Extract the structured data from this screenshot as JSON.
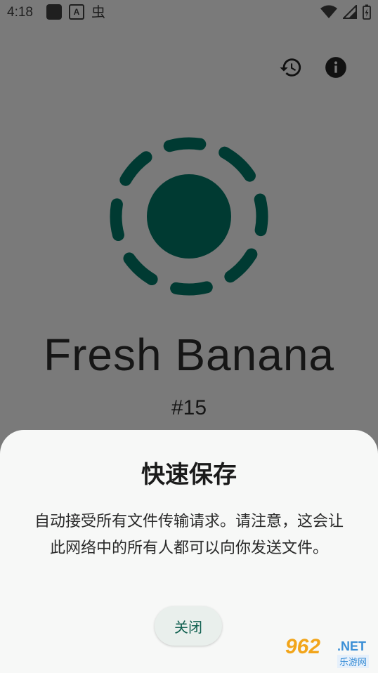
{
  "status_bar": {
    "time": "4:18",
    "a_label": "A",
    "bug_glyph": "虫"
  },
  "actions": {
    "history_icon": "history-icon",
    "info_icon": "info-icon"
  },
  "device": {
    "name": "Fresh Banana",
    "number": "#15"
  },
  "dialog": {
    "title": "快速保存",
    "body": "自动接受所有文件传输请求。请注意，这会让此网络中的所有人都可以向你发送文件。",
    "close_label": "关闭"
  },
  "watermark": {
    "number": "962",
    "suffix": ".NET",
    "site": "乐游网"
  },
  "colors": {
    "logo": "#003a32",
    "accent": "#0f5f4f",
    "scrim": "#7a7a7a"
  }
}
